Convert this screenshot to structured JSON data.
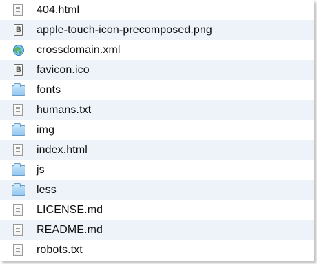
{
  "file_list": {
    "items": [
      {
        "label": "404.html",
        "icon": "document-icon",
        "type": "document"
      },
      {
        "label": "apple-touch-icon-precomposed.png",
        "icon": "image-file-icon",
        "type": "image"
      },
      {
        "label": "crossdomain.xml",
        "icon": "xml-file-icon",
        "type": "xml"
      },
      {
        "label": "favicon.ico",
        "icon": "image-file-icon",
        "type": "image"
      },
      {
        "label": "fonts",
        "icon": "folder-icon",
        "type": "folder"
      },
      {
        "label": "humans.txt",
        "icon": "document-icon",
        "type": "document"
      },
      {
        "label": "img",
        "icon": "folder-icon",
        "type": "folder"
      },
      {
        "label": "index.html",
        "icon": "document-icon",
        "type": "document"
      },
      {
        "label": "js",
        "icon": "folder-icon",
        "type": "folder"
      },
      {
        "label": "less",
        "icon": "folder-icon",
        "type": "folder"
      },
      {
        "label": "LICENSE.md",
        "icon": "document-icon",
        "type": "document"
      },
      {
        "label": "README.md",
        "icon": "document-icon",
        "type": "document"
      },
      {
        "label": "robots.txt",
        "icon": "document-icon",
        "type": "document"
      }
    ]
  },
  "colors": {
    "alternate_row": "#eef3fa",
    "folder_fill": "#93c7ee",
    "folder_border": "#6a9cc7"
  }
}
